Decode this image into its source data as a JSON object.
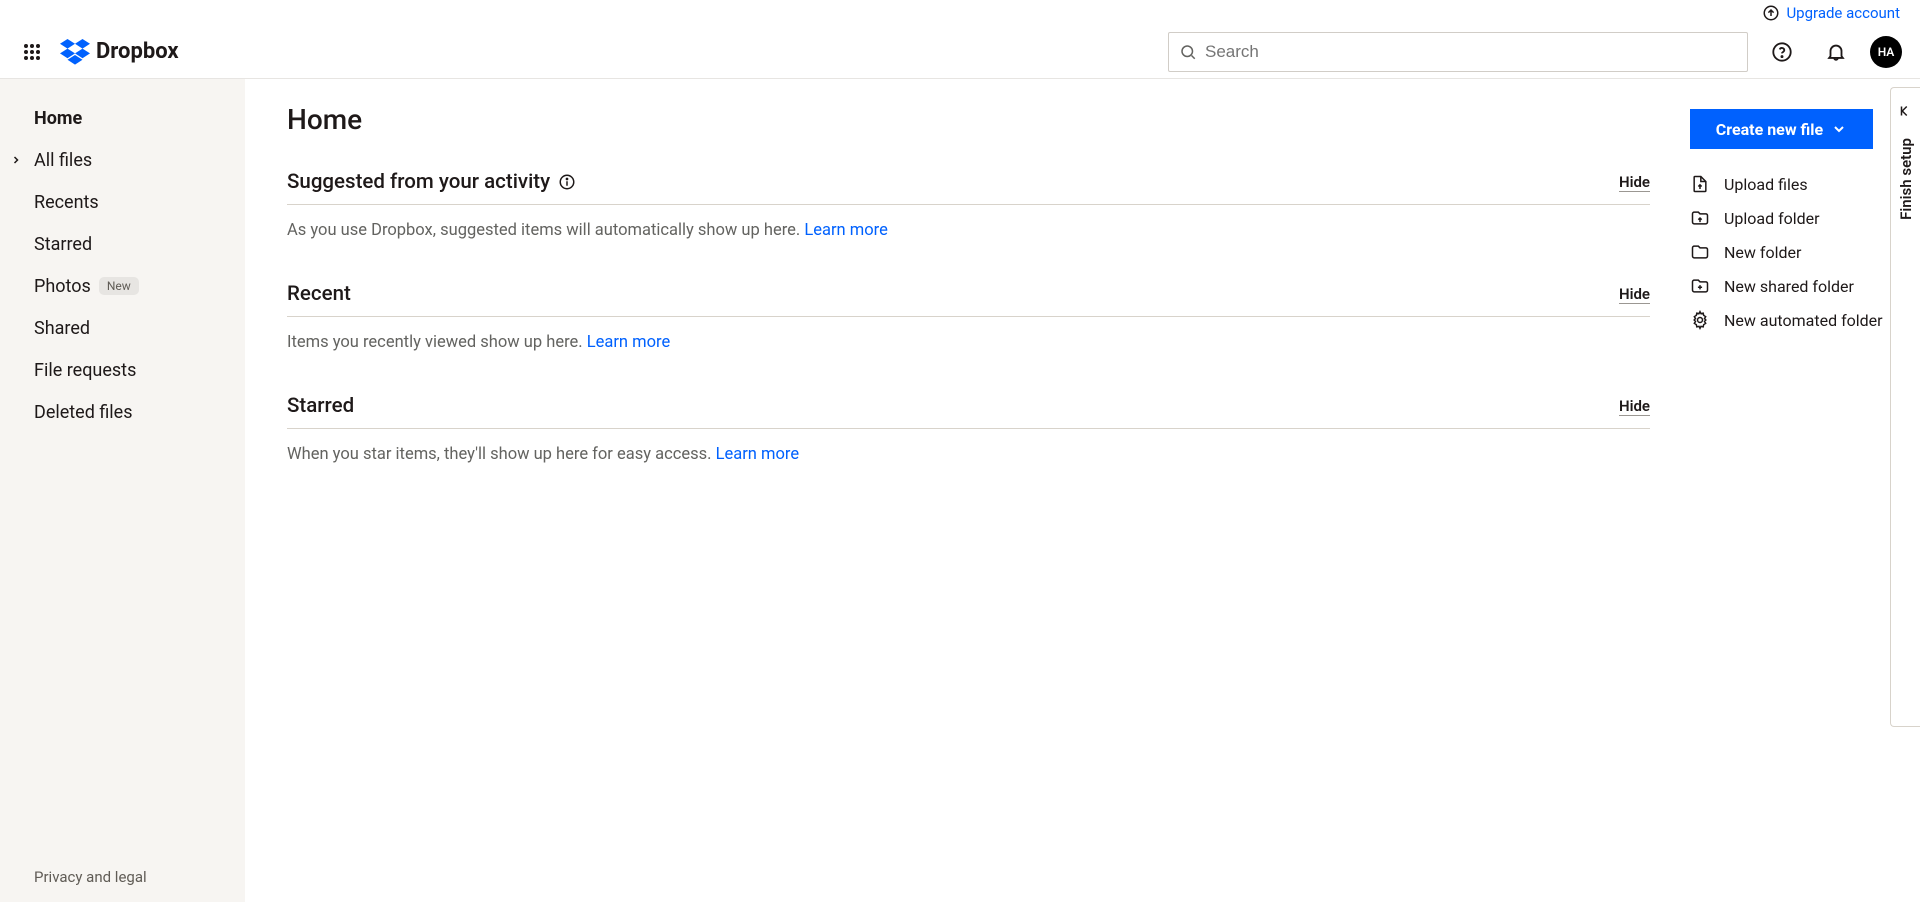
{
  "header": {
    "upgrade": "Upgrade account",
    "brand": "Dropbox",
    "search_placeholder": "Search",
    "avatar_initials": "HA"
  },
  "sidebar": {
    "items": [
      {
        "label": "Home",
        "active": true,
        "expandable": false
      },
      {
        "label": "All files",
        "active": false,
        "expandable": true
      },
      {
        "label": "Recents",
        "active": false,
        "expandable": false
      },
      {
        "label": "Starred",
        "active": false,
        "expandable": false
      },
      {
        "label": "Photos",
        "active": false,
        "expandable": false,
        "badge": "New"
      },
      {
        "label": "Shared",
        "active": false,
        "expandable": false
      },
      {
        "label": "File requests",
        "active": false,
        "expandable": false
      },
      {
        "label": "Deleted files",
        "active": false,
        "expandable": false
      }
    ],
    "footer": "Privacy and legal"
  },
  "page": {
    "title": "Home",
    "sections": [
      {
        "title": "Suggested from your activity",
        "info_icon": true,
        "hide": "Hide",
        "text": "As you use Dropbox, suggested items will automatically show up here. ",
        "link": "Learn more"
      },
      {
        "title": "Recent",
        "info_icon": false,
        "hide": "Hide",
        "text": "Items you recently viewed show up here. ",
        "link": "Learn more"
      },
      {
        "title": "Starred",
        "info_icon": false,
        "hide": "Hide",
        "text": "When you star items, they'll show up here for easy access. ",
        "link": "Learn more"
      }
    ]
  },
  "actions": {
    "create_btn": "Create new file",
    "items": [
      {
        "label": "Upload files",
        "icon": "file-upload"
      },
      {
        "label": "Upload folder",
        "icon": "folder-upload"
      },
      {
        "label": "New folder",
        "icon": "folder"
      },
      {
        "label": "New shared folder",
        "icon": "folder-shared"
      },
      {
        "label": "New automated folder",
        "icon": "folder-automated"
      }
    ]
  },
  "drawer": {
    "label": "Finish setup"
  }
}
